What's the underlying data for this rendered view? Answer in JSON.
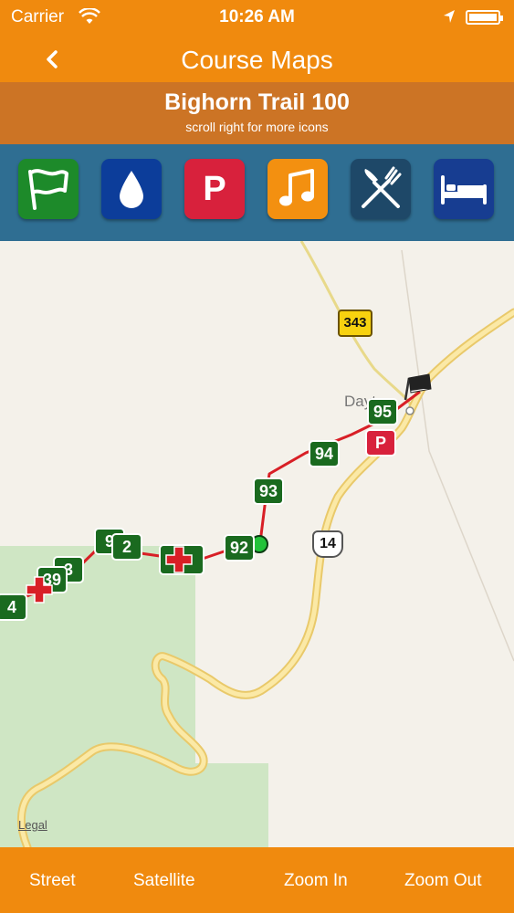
{
  "status_bar": {
    "carrier": "Carrier",
    "time": "10:26 AM"
  },
  "nav": {
    "title": "Course Maps"
  },
  "subheader": {
    "race_name": "Bighorn Trail 100",
    "hint": "scroll right for more icons"
  },
  "icon_bar": {
    "icons": [
      {
        "name": "flag-icon",
        "color": "#1d8a2a"
      },
      {
        "name": "water-drop-icon",
        "color": "#0c3d9a"
      },
      {
        "name": "parking-icon",
        "color": "#d8213c",
        "label": "P"
      },
      {
        "name": "music-note-icon",
        "color": "#f39010"
      },
      {
        "name": "fork-knife-icon",
        "color": "#1e4868"
      },
      {
        "name": "bed-icon",
        "color": "#173d91"
      }
    ]
  },
  "map": {
    "route_color": "#d81f26",
    "aid_station_color": "#d81f26",
    "mile_marker_color": "#1a6a1f",
    "mile_markers": [
      "95",
      "94",
      "93",
      "92",
      "2",
      "3",
      "39",
      "4",
      "9"
    ],
    "highway_label": "14",
    "state_route_label": "343",
    "town_label": "Dayton",
    "parking_label": "P",
    "legal": "Legal"
  },
  "toolbar": {
    "street": "Street",
    "satellite": "Satellite",
    "zoom_in": "Zoom In",
    "zoom_out": "Zoom Out"
  }
}
